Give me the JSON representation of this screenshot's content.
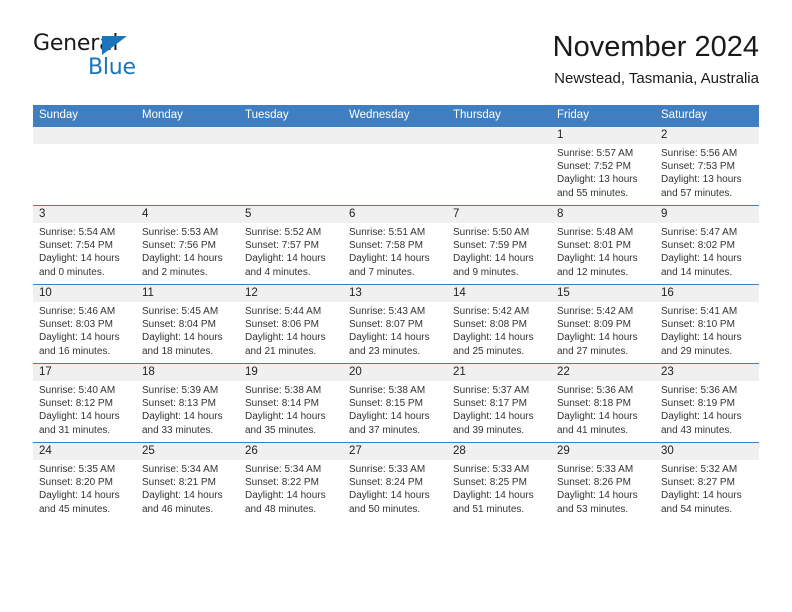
{
  "brand": {
    "name_part1": "General",
    "name_part2": "Blue",
    "accent_color": "#1b75bb"
  },
  "header": {
    "title": "November 2024",
    "subtitle": "Newstead, Tasmania, Australia"
  },
  "theme": {
    "header_row_color": "#3f7fc1",
    "daynum_band_color": "#f0f0f0",
    "text_color": "#222222"
  },
  "calendar": {
    "weekday_headers": [
      "Sunday",
      "Monday",
      "Tuesday",
      "Wednesday",
      "Thursday",
      "Friday",
      "Saturday"
    ],
    "weeks": [
      [
        {
          "day": "",
          "lines": []
        },
        {
          "day": "",
          "lines": []
        },
        {
          "day": "",
          "lines": []
        },
        {
          "day": "",
          "lines": []
        },
        {
          "day": "",
          "lines": []
        },
        {
          "day": "1",
          "lines": [
            "Sunrise: 5:57 AM",
            "Sunset: 7:52 PM",
            "Daylight: 13 hours and 55 minutes."
          ]
        },
        {
          "day": "2",
          "lines": [
            "Sunrise: 5:56 AM",
            "Sunset: 7:53 PM",
            "Daylight: 13 hours and 57 minutes."
          ]
        }
      ],
      [
        {
          "day": "3",
          "lines": [
            "Sunrise: 5:54 AM",
            "Sunset: 7:54 PM",
            "Daylight: 14 hours and 0 minutes."
          ]
        },
        {
          "day": "4",
          "lines": [
            "Sunrise: 5:53 AM",
            "Sunset: 7:56 PM",
            "Daylight: 14 hours and 2 minutes."
          ]
        },
        {
          "day": "5",
          "lines": [
            "Sunrise: 5:52 AM",
            "Sunset: 7:57 PM",
            "Daylight: 14 hours and 4 minutes."
          ]
        },
        {
          "day": "6",
          "lines": [
            "Sunrise: 5:51 AM",
            "Sunset: 7:58 PM",
            "Daylight: 14 hours and 7 minutes."
          ]
        },
        {
          "day": "7",
          "lines": [
            "Sunrise: 5:50 AM",
            "Sunset: 7:59 PM",
            "Daylight: 14 hours and 9 minutes."
          ]
        },
        {
          "day": "8",
          "lines": [
            "Sunrise: 5:48 AM",
            "Sunset: 8:01 PM",
            "Daylight: 14 hours and 12 minutes."
          ]
        },
        {
          "day": "9",
          "lines": [
            "Sunrise: 5:47 AM",
            "Sunset: 8:02 PM",
            "Daylight: 14 hours and 14 minutes."
          ]
        }
      ],
      [
        {
          "day": "10",
          "lines": [
            "Sunrise: 5:46 AM",
            "Sunset: 8:03 PM",
            "Daylight: 14 hours and 16 minutes."
          ]
        },
        {
          "day": "11",
          "lines": [
            "Sunrise: 5:45 AM",
            "Sunset: 8:04 PM",
            "Daylight: 14 hours and 18 minutes."
          ]
        },
        {
          "day": "12",
          "lines": [
            "Sunrise: 5:44 AM",
            "Sunset: 8:06 PM",
            "Daylight: 14 hours and 21 minutes."
          ]
        },
        {
          "day": "13",
          "lines": [
            "Sunrise: 5:43 AM",
            "Sunset: 8:07 PM",
            "Daylight: 14 hours and 23 minutes."
          ]
        },
        {
          "day": "14",
          "lines": [
            "Sunrise: 5:42 AM",
            "Sunset: 8:08 PM",
            "Daylight: 14 hours and 25 minutes."
          ]
        },
        {
          "day": "15",
          "lines": [
            "Sunrise: 5:42 AM",
            "Sunset: 8:09 PM",
            "Daylight: 14 hours and 27 minutes."
          ]
        },
        {
          "day": "16",
          "lines": [
            "Sunrise: 5:41 AM",
            "Sunset: 8:10 PM",
            "Daylight: 14 hours and 29 minutes."
          ]
        }
      ],
      [
        {
          "day": "17",
          "lines": [
            "Sunrise: 5:40 AM",
            "Sunset: 8:12 PM",
            "Daylight: 14 hours and 31 minutes."
          ]
        },
        {
          "day": "18",
          "lines": [
            "Sunrise: 5:39 AM",
            "Sunset: 8:13 PM",
            "Daylight: 14 hours and 33 minutes."
          ]
        },
        {
          "day": "19",
          "lines": [
            "Sunrise: 5:38 AM",
            "Sunset: 8:14 PM",
            "Daylight: 14 hours and 35 minutes."
          ]
        },
        {
          "day": "20",
          "lines": [
            "Sunrise: 5:38 AM",
            "Sunset: 8:15 PM",
            "Daylight: 14 hours and 37 minutes."
          ]
        },
        {
          "day": "21",
          "lines": [
            "Sunrise: 5:37 AM",
            "Sunset: 8:17 PM",
            "Daylight: 14 hours and 39 minutes."
          ]
        },
        {
          "day": "22",
          "lines": [
            "Sunrise: 5:36 AM",
            "Sunset: 8:18 PM",
            "Daylight: 14 hours and 41 minutes."
          ]
        },
        {
          "day": "23",
          "lines": [
            "Sunrise: 5:36 AM",
            "Sunset: 8:19 PM",
            "Daylight: 14 hours and 43 minutes."
          ]
        }
      ],
      [
        {
          "day": "24",
          "lines": [
            "Sunrise: 5:35 AM",
            "Sunset: 8:20 PM",
            "Daylight: 14 hours and 45 minutes."
          ]
        },
        {
          "day": "25",
          "lines": [
            "Sunrise: 5:34 AM",
            "Sunset: 8:21 PM",
            "Daylight: 14 hours and 46 minutes."
          ]
        },
        {
          "day": "26",
          "lines": [
            "Sunrise: 5:34 AM",
            "Sunset: 8:22 PM",
            "Daylight: 14 hours and 48 minutes."
          ]
        },
        {
          "day": "27",
          "lines": [
            "Sunrise: 5:33 AM",
            "Sunset: 8:24 PM",
            "Daylight: 14 hours and 50 minutes."
          ]
        },
        {
          "day": "28",
          "lines": [
            "Sunrise: 5:33 AM",
            "Sunset: 8:25 PM",
            "Daylight: 14 hours and 51 minutes."
          ]
        },
        {
          "day": "29",
          "lines": [
            "Sunrise: 5:33 AM",
            "Sunset: 8:26 PM",
            "Daylight: 14 hours and 53 minutes."
          ]
        },
        {
          "day": "30",
          "lines": [
            "Sunrise: 5:32 AM",
            "Sunset: 8:27 PM",
            "Daylight: 14 hours and 54 minutes."
          ]
        }
      ]
    ]
  }
}
